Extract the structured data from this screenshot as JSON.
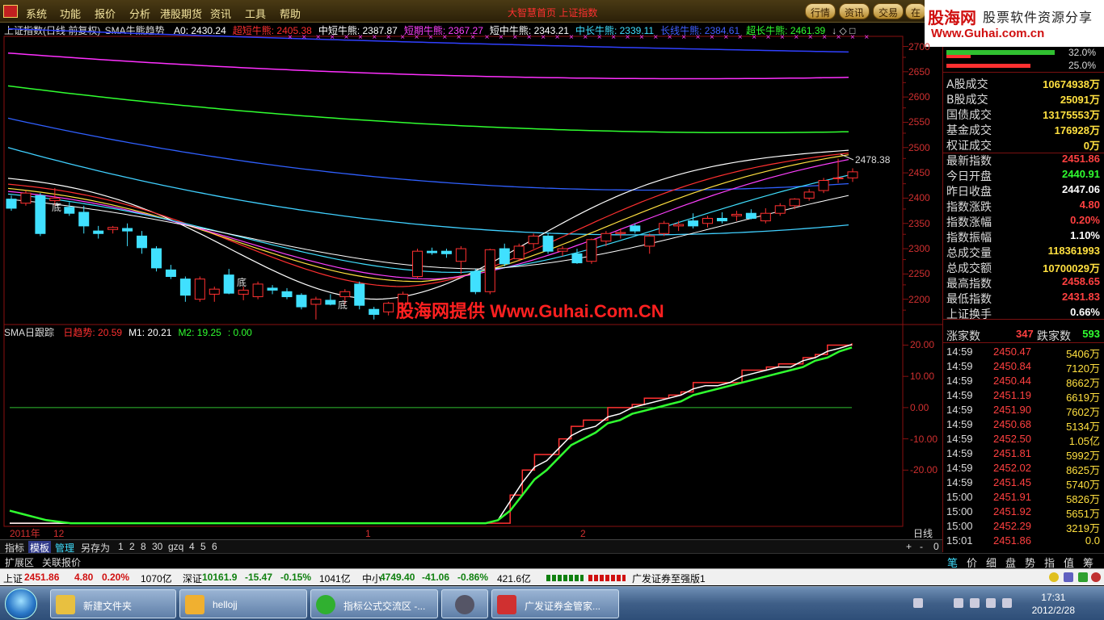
{
  "menu": {
    "items": [
      "系统",
      "功能",
      "报价",
      "分析",
      "港股期货",
      "资讯",
      "工具",
      "帮助"
    ],
    "center_title": "大智慧首页 上证指数",
    "right_buttons": [
      "行情",
      "资讯",
      "交易",
      "在"
    ]
  },
  "brand": {
    "name": "股海网",
    "slogan": "股票软件资源分享",
    "url": "Www.Guhai.com.cn"
  },
  "main_title": {
    "index": "上证指数(日线 前复权)",
    "indicator": "SMA牛熊趋势",
    "items": [
      {
        "label": "A0: 2430.24",
        "color": "#ffffff"
      },
      {
        "label": "超短牛熊: 2405.38",
        "color": "#ff3030"
      },
      {
        "label": "中短牛熊: 2387.87",
        "color": "#ffffff"
      },
      {
        "label": "短期牛熊: 2367.27",
        "color": "#ff40ff"
      },
      {
        "label": "短中牛熊: 2343.21",
        "color": "#ffffff"
      },
      {
        "label": "中长牛熊: 2339.11",
        "color": "#40e0ff"
      },
      {
        "label": "长线牛熊: 2384.61",
        "color": "#4060ff"
      },
      {
        "label": "超长牛熊: 2461.39",
        "color": "#30ff30"
      }
    ]
  },
  "price_axis": [
    "2700",
    "2650",
    "2600",
    "2550",
    "2500",
    "2450",
    "2400",
    "2350",
    "2300",
    "2250",
    "2200"
  ],
  "annotations": {
    "high_marker": "2478.38",
    "bottom_label": "底",
    "watermark": "股海网提供 Www.Guhai.Com.CN"
  },
  "sub_title": {
    "name": "SMA日跟踪",
    "items": [
      {
        "label": "日趋势: 20.59",
        "color": "#ff3030"
      },
      {
        "label": "M1: 20.21",
        "color": "#ffffff"
      },
      {
        "label": "M2: 19.25",
        "color": "#30ff30"
      },
      {
        "label": ": 0.00",
        "color": "#30ff30"
      }
    ]
  },
  "sub_axis": [
    "20.00",
    "10.00",
    "0.00",
    "-10.00",
    "-20.00"
  ],
  "date_axis": {
    "year": "2011年",
    "m1": "12",
    "m2": "1",
    "m3": "2",
    "period": "日线"
  },
  "stats": [
    {
      "k": "A股成交",
      "v": "10674938万",
      "c": "#ffe040"
    },
    {
      "k": "B股成交",
      "v": "25091万",
      "c": "#ffe040"
    },
    {
      "k": "国债成交",
      "v": "13175553万",
      "c": "#ffe040"
    },
    {
      "k": "基金成交",
      "v": "176928万",
      "c": "#ffe040"
    },
    {
      "k": "权证成交",
      "v": "0万",
      "c": "#ffe040"
    },
    {
      "k": "最新指数",
      "v": "2451.86",
      "c": "#ff4040"
    },
    {
      "k": "今日开盘",
      "v": "2440.91",
      "c": "#30ff30"
    },
    {
      "k": "昨日收盘",
      "v": "2447.06",
      "c": "#ffffff"
    },
    {
      "k": "指数涨跌",
      "v": "4.80",
      "c": "#ff4040"
    },
    {
      "k": "指数涨幅",
      "v": "0.20%",
      "c": "#ff4040"
    },
    {
      "k": "指数振幅",
      "v": "1.10%",
      "c": "#ffffff"
    },
    {
      "k": "总成交量",
      "v": "118361993",
      "c": "#ffe040"
    },
    {
      "k": "总成交额",
      "v": "10700029万",
      "c": "#ffe040"
    },
    {
      "k": "最高指数",
      "v": "2458.65",
      "c": "#ff4040"
    },
    {
      "k": "最低指数",
      "v": "2431.83",
      "c": "#ff4040"
    },
    {
      "k": "上证换手",
      "v": "0.66%",
      "c": "#ffffff"
    }
  ],
  "mini_bars": {
    "a": "32.0%",
    "b": "25.0%"
  },
  "breadth": {
    "up_label": "涨家数",
    "up": "347",
    "down_label": "跌家数",
    "down": "593"
  },
  "ticks": [
    {
      "t": "14:59",
      "p": "2450.47",
      "v": "5406万"
    },
    {
      "t": "14:59",
      "p": "2450.84",
      "v": "7120万"
    },
    {
      "t": "14:59",
      "p": "2450.44",
      "v": "8662万"
    },
    {
      "t": "14:59",
      "p": "2451.19",
      "v": "6619万"
    },
    {
      "t": "14:59",
      "p": "2451.90",
      "v": "7602万"
    },
    {
      "t": "14:59",
      "p": "2450.68",
      "v": "5134万"
    },
    {
      "t": "14:59",
      "p": "2452.50",
      "v": "1.05亿"
    },
    {
      "t": "14:59",
      "p": "2451.81",
      "v": "5992万"
    },
    {
      "t": "14:59",
      "p": "2452.02",
      "v": "8625万"
    },
    {
      "t": "14:59",
      "p": "2451.45",
      "v": "5740万"
    },
    {
      "t": "15:00",
      "p": "2451.91",
      "v": "5826万"
    },
    {
      "t": "15:00",
      "p": "2451.92",
      "v": "5651万"
    },
    {
      "t": "15:00",
      "p": "2452.29",
      "v": "3219万"
    },
    {
      "t": "15:01",
      "p": "2451.86",
      "v": "0.0"
    }
  ],
  "controls": {
    "tabs": [
      "指标",
      "模板",
      "管理",
      "另存为"
    ],
    "nums": [
      "1",
      "2",
      "8",
      "30",
      "gzq",
      "4",
      "5",
      "6"
    ],
    "ext": [
      "扩展区",
      "关联报价"
    ],
    "right_tabs": [
      "笔",
      "价",
      "细",
      "盘",
      "势",
      "指",
      "值",
      "筹"
    ],
    "zoom": [
      "+",
      "-",
      "0"
    ]
  },
  "status": {
    "sh_label": "上证",
    "sh_val": "2451.86",
    "sh_chg": "4.80",
    "sh_pct": "0.20%",
    "sh_amt": "1070亿",
    "sz_label": "深证",
    "sz_val": "10161.9",
    "sz_chg": "-15.47",
    "sz_pct": "-0.15%",
    "sz_amt": "1041亿",
    "zx_label": "中小",
    "zx_val": "4749.40",
    "zx_chg": "-41.06",
    "zx_pct": "-0.86%",
    "zx_amt": "421.6亿",
    "broker": "广发证券至强版1"
  },
  "taskbar": {
    "tasks": [
      "新建文件夹",
      "hellojj",
      "指标公式交流区 -...",
      "",
      "广发证券金管家..."
    ],
    "time": "17:31",
    "date": "2012/2/28"
  },
  "colors": {
    "up": "#ff3030",
    "down": "#40e0ff",
    "accent": "#d01010"
  },
  "chart_data": [
    {
      "type": "candlestick",
      "title": "上证指数(日线 前复权)",
      "ylim": [
        2150,
        2720
      ],
      "ohlc": [
        [
          2398,
          2405,
          2375,
          2380
        ],
        [
          2390,
          2415,
          2385,
          2410
        ],
        [
          2405,
          2410,
          2325,
          2330
        ],
        [
          2395,
          2420,
          2385,
          2400
        ],
        [
          2382,
          2392,
          2365,
          2370
        ],
        [
          2372,
          2385,
          2330,
          2345
        ],
        [
          2335,
          2345,
          2320,
          2330
        ],
        [
          2338,
          2345,
          2330,
          2342
        ],
        [
          2340,
          2350,
          2305,
          2335
        ],
        [
          2325,
          2335,
          2290,
          2302
        ],
        [
          2300,
          2305,
          2255,
          2262
        ],
        [
          2258,
          2268,
          2240,
          2245
        ],
        [
          2240,
          2245,
          2195,
          2208
        ],
        [
          2200,
          2245,
          2195,
          2240
        ],
        [
          2210,
          2225,
          2195,
          2220
        ],
        [
          2248,
          2260,
          2210,
          2212
        ],
        [
          2210,
          2225,
          2198,
          2218
        ],
        [
          2205,
          2235,
          2200,
          2230
        ],
        [
          2222,
          2228,
          2210,
          2218
        ],
        [
          2215,
          2222,
          2200,
          2205
        ],
        [
          2208,
          2212,
          2180,
          2185
        ],
        [
          2190,
          2205,
          2160,
          2200
        ],
        [
          2198,
          2210,
          2188,
          2190
        ],
        [
          2205,
          2220,
          2190,
          2215
        ],
        [
          2230,
          2235,
          2180,
          2188
        ],
        [
          2180,
          2185,
          2160,
          2170
        ],
        [
          2175,
          2195,
          2168,
          2192
        ],
        [
          2190,
          2215,
          2170,
          2210
        ],
        [
          2245,
          2300,
          2240,
          2295
        ],
        [
          2295,
          2302,
          2288,
          2292
        ],
        [
          2295,
          2300,
          2282,
          2290
        ],
        [
          2275,
          2305,
          2250,
          2300
        ],
        [
          2255,
          2260,
          2210,
          2215
        ],
        [
          2215,
          2300,
          2210,
          2298
        ],
        [
          2300,
          2310,
          2265,
          2270
        ],
        [
          2280,
          2310,
          2275,
          2305
        ],
        [
          2310,
          2330,
          2300,
          2325
        ],
        [
          2325,
          2330,
          2290,
          2295
        ],
        [
          2295,
          2305,
          2285,
          2300
        ],
        [
          2290,
          2300,
          2270,
          2272
        ],
        [
          2275,
          2320,
          2270,
          2318
        ],
        [
          2315,
          2335,
          2305,
          2330
        ],
        [
          2330,
          2340,
          2320,
          2332
        ],
        [
          2345,
          2350,
          2330,
          2335
        ],
        [
          2305,
          2330,
          2290,
          2325
        ],
        [
          2330,
          2355,
          2325,
          2350
        ],
        [
          2345,
          2355,
          2335,
          2348
        ],
        [
          2355,
          2370,
          2340,
          2345
        ],
        [
          2350,
          2365,
          2342,
          2360
        ],
        [
          2360,
          2372,
          2350,
          2355
        ],
        [
          2365,
          2375,
          2355,
          2368
        ],
        [
          2370,
          2378,
          2358,
          2360
        ],
        [
          2355,
          2380,
          2350,
          2370
        ],
        [
          2370,
          2390,
          2365,
          2385
        ],
        [
          2385,
          2400,
          2378,
          2398
        ],
        [
          2400,
          2418,
          2395,
          2412
        ],
        [
          2415,
          2440,
          2410,
          2435
        ],
        [
          2440,
          2478,
          2430,
          2440
        ],
        [
          2440,
          2459,
          2432,
          2452
        ]
      ],
      "series": [
        {
          "name": "超长牛熊",
          "color": "#30ff30",
          "values": [
            2660,
            2652,
            2640,
            2625,
            2610,
            2590,
            2560,
            2530,
            2505,
            2490,
            2485,
            2478,
            2472,
            2466,
            2463,
            2461
          ]
        },
        {
          "name": "长线牛熊",
          "color": "#4060ff",
          "values": [
            2555,
            2540,
            2520,
            2500,
            2482,
            2460,
            2440,
            2420,
            2405,
            2395,
            2390,
            2386,
            2385,
            2384,
            2384,
            2385
          ]
        }
      ]
    },
    {
      "type": "line",
      "title": "SMA日跟踪",
      "ylim": [
        -38,
        24
      ],
      "series": [
        {
          "name": "日趋势",
          "color": "#ff3030",
          "values": [
            -37,
            -37,
            -37,
            -37,
            -37,
            -37,
            -37,
            -37,
            -37,
            -37,
            -37,
            -37,
            -37,
            -37,
            -37,
            -37,
            -37,
            -37,
            -37,
            -37,
            -37,
            -37,
            -37,
            -37,
            -37,
            -37,
            -37,
            -37,
            -37,
            -37,
            -37,
            -37,
            -37,
            -37,
            -37,
            -37,
            -37,
            -37,
            -37,
            -37,
            -37,
            -28,
            -20,
            -15,
            -15,
            -10,
            -6,
            -4,
            -4,
            0,
            0,
            1,
            3,
            3,
            4,
            5,
            8,
            8,
            8,
            8,
            12,
            12,
            13,
            14,
            14,
            16,
            17,
            20,
            20,
            20.59
          ]
        },
        {
          "name": "M1",
          "color": "#ffffff",
          "values": [
            -37,
            -37,
            -37,
            -37,
            -37,
            -37,
            -37,
            -37,
            -37,
            -37,
            -37,
            -37,
            -37,
            -37,
            -37,
            -37,
            -37,
            -37,
            -37,
            -37,
            -37,
            -37,
            -37,
            -37,
            -37,
            -37,
            -37,
            -37,
            -37,
            -37,
            -37,
            -37,
            -37,
            -37,
            -37,
            -37,
            -37,
            -37,
            -37,
            -37,
            -36,
            -30,
            -24,
            -19,
            -17,
            -13,
            -9,
            -7,
            -6,
            -3,
            -2,
            0,
            1,
            2,
            3,
            4,
            6,
            7,
            7,
            8,
            10,
            11,
            12,
            13,
            13,
            15,
            16,
            18,
            19,
            20.21
          ]
        },
        {
          "name": "M2",
          "color": "#30ff30",
          "values": [
            -33,
            -34,
            -35,
            -36,
            -36.5,
            -37,
            -37,
            -37,
            -37,
            -37,
            -37,
            -37,
            -37,
            -37,
            -37,
            -37,
            -37,
            -37,
            -37,
            -37,
            -37,
            -37,
            -37,
            -37,
            -37,
            -37,
            -37,
            -37,
            -37,
            -37,
            -37,
            -37,
            -37,
            -37,
            -37,
            -37,
            -37,
            -37,
            -37,
            -37,
            -36,
            -33,
            -28,
            -23,
            -20,
            -16,
            -12,
            -10,
            -8,
            -5,
            -4,
            -2,
            -1,
            0,
            1,
            2,
            4,
            5,
            6,
            7,
            8,
            9,
            10,
            11,
            12,
            13,
            15,
            16,
            18,
            19.25
          ]
        }
      ]
    }
  ]
}
